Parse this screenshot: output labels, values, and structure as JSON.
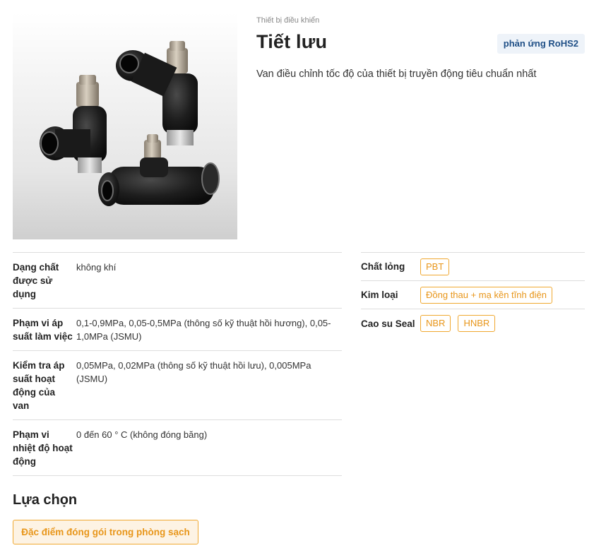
{
  "product": {
    "category": "Thiết bị điều khiển",
    "title": "Tiết lưu",
    "rohs_badge": "phản ứng RoHS2",
    "description": "Van điều chỉnh tốc độ của thiết bị truyền động tiêu chuẩn nhất"
  },
  "specs": [
    {
      "label": "Dạng chất được sử dụng",
      "value": "không khí"
    },
    {
      "label": "Phạm vi áp suất làm việc",
      "value": "0,1-0,9MPa, 0,05-0,5MPa (thông số kỹ thuật hồi hương), 0,05-1,0MPa (JSMU)"
    },
    {
      "label": "Kiểm tra áp suất hoạt động của van",
      "value": "0,05MPa, 0,02MPa (thông số kỹ thuật hồi lưu), 0,005MPa (JSMU)"
    },
    {
      "label": "Phạm vi nhiệt độ hoạt động",
      "value": "0 đến 60 ° C (không đóng băng)"
    }
  ],
  "materials": [
    {
      "label": "Chất lỏng",
      "tags": [
        "PBT"
      ]
    },
    {
      "label": "Kim loại",
      "tags": [
        "Đồng thau + mạ kền tĩnh điện"
      ]
    },
    {
      "label": "Cao su Seal",
      "tags": [
        "NBR",
        "HNBR"
      ]
    }
  ],
  "options": {
    "heading": "Lựa chọn",
    "button_label": "Đặc điểm đóng gói trong phòng sạch"
  },
  "colors": {
    "accent_orange": "#f0a830",
    "rohs_blue": "#1f4f86",
    "fitting_body": "#1c1c1c",
    "brass": "#b5aa98"
  },
  "image": {
    "icon": "speed-controller-fittings-photo"
  }
}
